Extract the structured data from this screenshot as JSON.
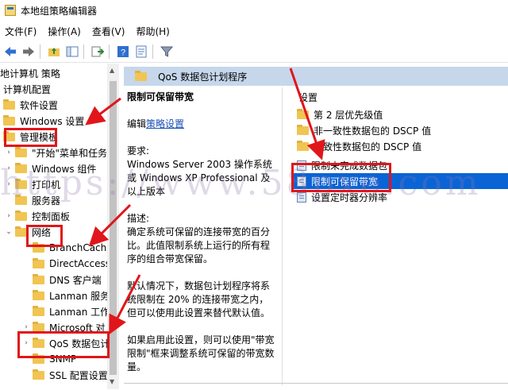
{
  "window": {
    "title": "本地组策略编辑器"
  },
  "menu": [
    "文件(F)",
    "操作(A)",
    "查看(V)",
    "帮助(H)"
  ],
  "toolbar_icons": [
    "back-arrow-icon",
    "forward-arrow-icon",
    "folder-up-icon",
    "show-hide-tree-icon",
    "export-list-icon",
    "help-icon",
    "properties-icon",
    "filter-icon"
  ],
  "tree": {
    "items": [
      {
        "label": "地计算机 策略",
        "twisty": ""
      },
      {
        "label": "计算机配置",
        "twisty": ""
      },
      {
        "label": "软件设置",
        "twisty": ""
      },
      {
        "label": "Windows 设置",
        "twisty": ""
      },
      {
        "label": "管理模板",
        "twisty": ""
      },
      {
        "label": "\"开始\"菜单和任务",
        "twisty": "›"
      },
      {
        "label": "Windows 组件",
        "twisty": "›"
      },
      {
        "label": "打印机",
        "twisty": "›"
      },
      {
        "label": "服务器",
        "twisty": ""
      },
      {
        "label": "控制面板",
        "twisty": "›"
      },
      {
        "label": "网络",
        "twisty": "⌄"
      },
      {
        "label": "BranchCach",
        "twisty": ""
      },
      {
        "label": "DirectAccess",
        "twisty": ""
      },
      {
        "label": "DNS 客户端",
        "twisty": ""
      },
      {
        "label": "Lanman 服务",
        "twisty": ""
      },
      {
        "label": "Lanman 工作",
        "twisty": ""
      },
      {
        "label": "Microsoft 对",
        "twisty": "›"
      },
      {
        "label": "QoS 数据包计",
        "twisty": "›"
      },
      {
        "label": "SNMP",
        "twisty": ""
      },
      {
        "label": "SSL 配置设置",
        "twisty": ""
      }
    ]
  },
  "right_pane": {
    "header": "QoS 数据包计划程序",
    "description": {
      "title": "限制可保留带宽",
      "edit_prefix": "编辑",
      "edit_link": "策略设置",
      "req_label": "要求:",
      "req_text": "Windows Server 2003 操作系统或 Windows XP Professional 及以上版本",
      "desc_label": "描述:",
      "desc_text": "确定系统可保留的连接带宽的百分比。此值限制系统上运行的所有程序的组合带宽保留。",
      "default_text": "默认情况下，数据包计划程序将系统限制在 20% 的连接带宽之内，但可以使用此设置来替代默认值。",
      "enable_text": "如果启用此设置，则可以使用\"带宽限制\"框来调整系统可保留的带宽数量。"
    },
    "list_header": "设置",
    "list": [
      {
        "label": "第 2 层优先级值",
        "icon": "folder"
      },
      {
        "label": "非一致性数据包的 DSCP 值",
        "icon": "folder"
      },
      {
        "label": "一致性数据包的 DSCP 值",
        "icon": "folder"
      },
      {
        "label": "限制未完成数据包",
        "icon": "policy"
      },
      {
        "label": "限制可保留带宽",
        "icon": "policy"
      },
      {
        "label": "设置定时器分辨率",
        "icon": "policy"
      }
    ]
  },
  "watermark": "https://www.58pxe.com",
  "colors": {
    "selection": "#0a64d6",
    "header_band": "#c6d7ec",
    "annotation": "#e0161a"
  }
}
